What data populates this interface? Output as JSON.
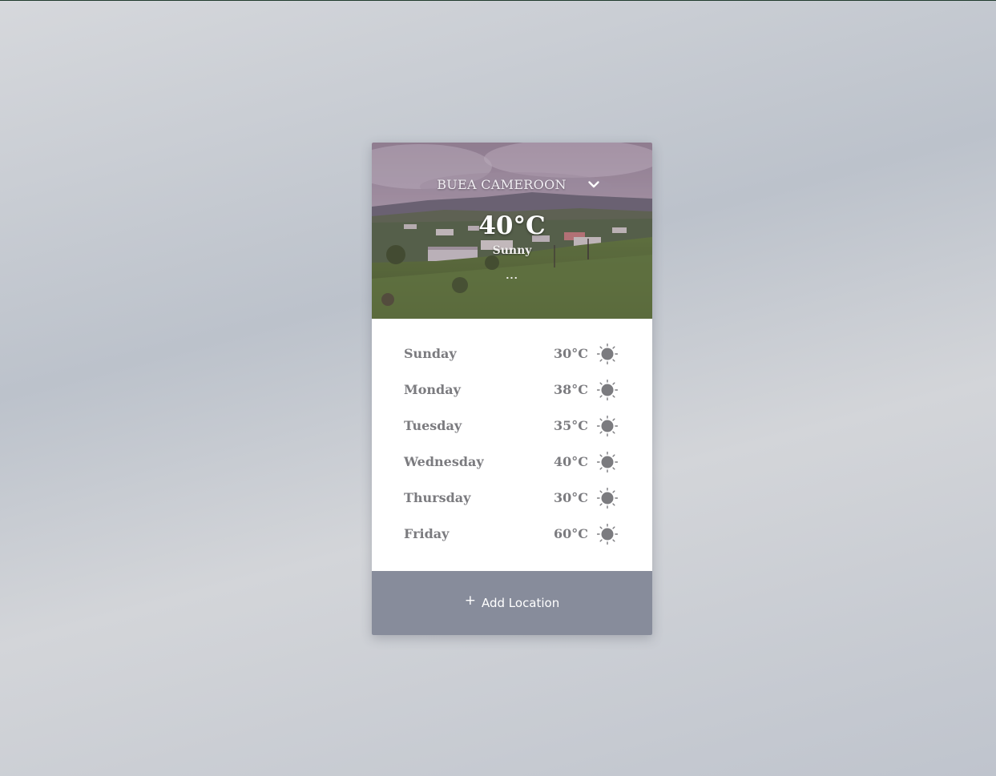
{
  "location": {
    "name": "BUEA CAMEROON",
    "dropdown_icon": "chevron-down-icon"
  },
  "current": {
    "temperature": "40°C",
    "condition": "Sunny",
    "more_label": "..."
  },
  "forecast": [
    {
      "day": "Sunday",
      "temp": "30°C",
      "icon": "sun-icon"
    },
    {
      "day": "Monday",
      "temp": "38°C",
      "icon": "sun-icon"
    },
    {
      "day": "Tuesday",
      "temp": "35°C",
      "icon": "sun-icon"
    },
    {
      "day": "Wednesday",
      "temp": "40°C",
      "icon": "sun-icon"
    },
    {
      "day": "Thursday",
      "temp": "30°C",
      "icon": "sun-icon"
    },
    {
      "day": "Friday",
      "temp": "60°C",
      "icon": "sun-icon"
    }
  ],
  "footer": {
    "plus_icon": "+",
    "add_label": "Add Location"
  },
  "colors": {
    "footer_bg": "#878c9b",
    "forecast_text": "#7b7b7f",
    "icon": "#7b7b7f"
  }
}
